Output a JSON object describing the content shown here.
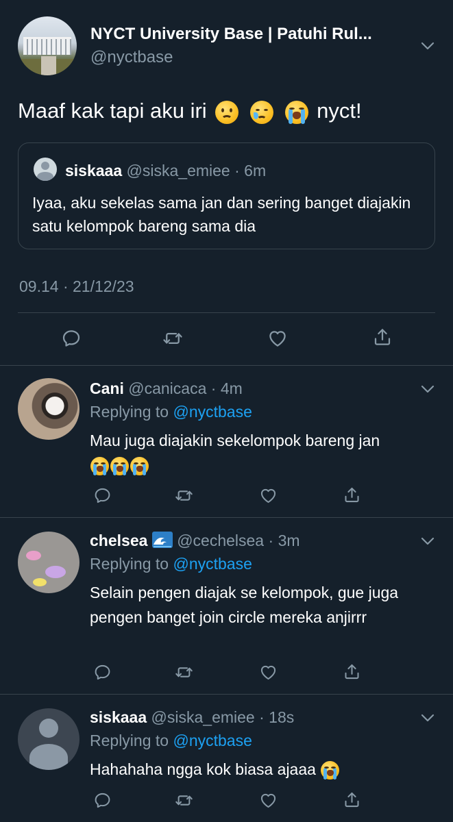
{
  "main_tweet": {
    "display_name": "NYCT University Base | Patuhi Rul...",
    "handle": "@nyctbase",
    "text_before": "Maaf kak tapi aku iri",
    "text_after": "nyct!",
    "timestamp": "09.14 · 21/12/23",
    "emoji": [
      "frowning-face",
      "crying-face",
      "loudly-crying-face"
    ]
  },
  "quoted_tweet": {
    "display_name": "siskaaa",
    "handle": "@siska_emiee",
    "time": "6m",
    "text": "Iyaa, aku sekelas sama jan dan sering banget diajakin satu kelompok bareng sama dia"
  },
  "replies": [
    {
      "display_name": "Cani",
      "handle": "@canicaca",
      "time": "4m",
      "replying_label": "Replying to",
      "replying_to": "@nyctbase",
      "text": "Mau juga diajakin sekelompok bareng jan",
      "emoji": [
        "loudly-crying-face",
        "loudly-crying-face",
        "loudly-crying-face"
      ]
    },
    {
      "display_name": "chelsea",
      "name_emoji": "water-wave",
      "handle": "@cechelsea",
      "time": "3m",
      "replying_label": "Replying to",
      "replying_to": "@nyctbase",
      "text": "Selain pengen diajak se kelompok, gue juga pengen banget join circle mereka anjirrr"
    },
    {
      "display_name": "siskaaa",
      "handle": "@siska_emiee",
      "time": "18s",
      "replying_label": "Replying to",
      "replying_to": "@nyctbase",
      "text": "Hahahaha ngga kok biasa ajaaa",
      "emoji": [
        "loudly-crying-face"
      ]
    }
  ],
  "colors": {
    "background": "#15202b",
    "muted_text": "#8899a6",
    "link": "#1da1f2",
    "divider": "#38444d"
  },
  "icons": [
    "chevron-down-icon",
    "reply-icon",
    "retweet-icon",
    "like-icon",
    "share-icon"
  ]
}
